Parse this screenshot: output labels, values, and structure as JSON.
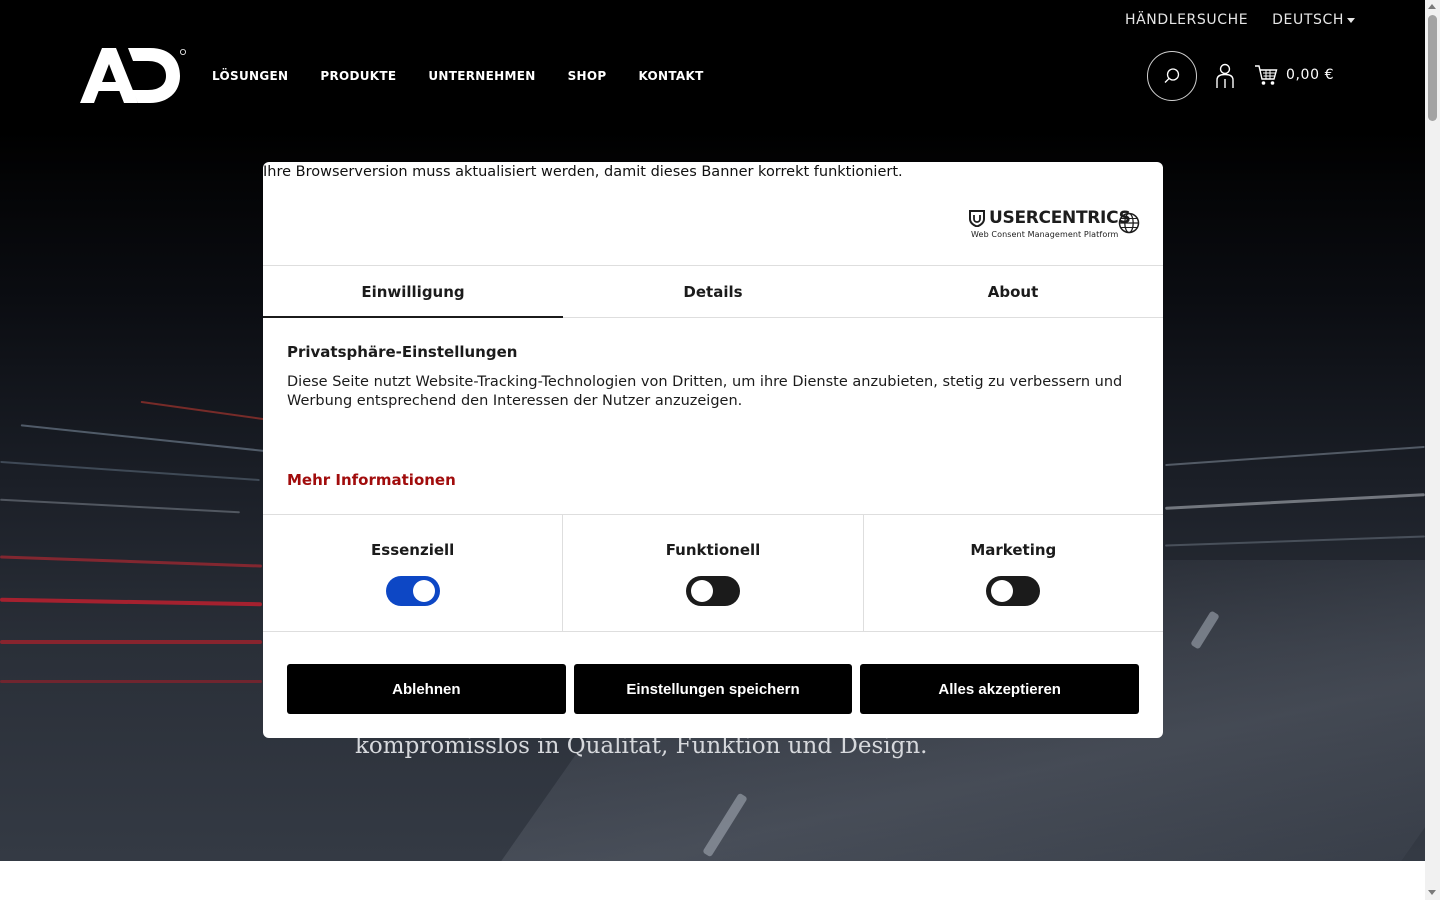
{
  "header": {
    "dealer_search": "HÄNDLERSUCHE",
    "language": "DEUTSCH",
    "logo_alt": "AD",
    "nav": [
      "LÖSUNGEN",
      "PRODUKTE",
      "UNTERNEHMEN",
      "SHOP",
      "KONTAKT"
    ],
    "cart_total": "0,00 €",
    "icons": [
      "search-icon",
      "account-icon",
      "cart-icon",
      "chevron-down-icon"
    ]
  },
  "hero": {
    "subline": "kompromisslos in Qualität, Funktion und Design."
  },
  "consent": {
    "browser_note": "Ihre Browserversion muss aktualisiert werden, damit dieses Banner korrekt funktioniert.",
    "brand": "USERCENTRICS",
    "brand_sub": "Web Consent Management Platform",
    "tabs": [
      {
        "label": "Einwilligung",
        "active": true
      },
      {
        "label": "Details",
        "active": false
      },
      {
        "label": "About",
        "active": false
      }
    ],
    "title": "Privatsphäre-Einstellungen",
    "text": "Diese Seite nutzt Website-Tracking-Technologien von Dritten, um ihre Dienste anzubieten, stetig zu verbessern und Werbung entsprechend den Interessen der Nutzer anzuzeigen.",
    "more_info": "Mehr Informationen",
    "categories": [
      {
        "label": "Essenziell",
        "enabled": true
      },
      {
        "label": "Funktionell",
        "enabled": false
      },
      {
        "label": "Marketing",
        "enabled": false
      }
    ],
    "buttons": {
      "deny": "Ablehnen",
      "save": "Einstellungen speichern",
      "accept_all": "Alles akzeptieren"
    },
    "colors": {
      "toggle_on": "#0d47c5",
      "toggle_off": "#1b1b1b",
      "link": "#a10c0c",
      "button_bg": "#000000"
    }
  }
}
